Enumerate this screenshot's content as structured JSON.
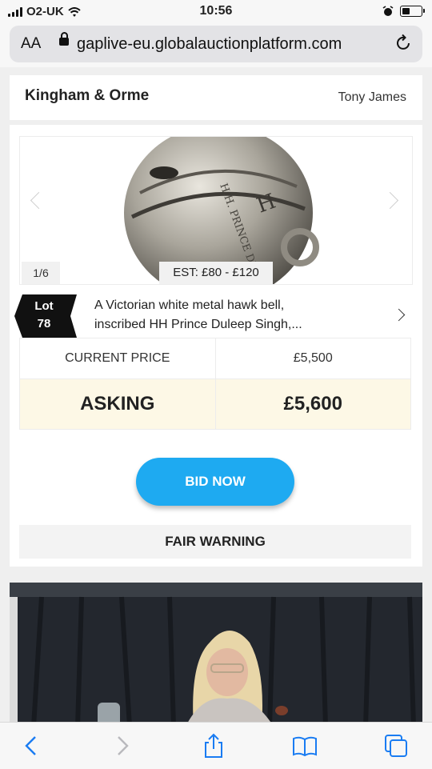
{
  "status_bar": {
    "carrier": "O2-UK",
    "time": "10:56"
  },
  "browser": {
    "text_size_label": "AA",
    "url": "gaplive-eu.globalauctionplatform.com"
  },
  "header": {
    "auction_house": "Kingham & Orme",
    "auctioneer": "Tony James"
  },
  "lot": {
    "image_counter": "1/6",
    "estimate": "EST: £80 - £120",
    "lot_label": "Lot",
    "lot_number": "78",
    "title_line1": "A Victorian white metal hawk bell,",
    "title_line2": "inscribed HH Prince Duleep Singh,...",
    "image_inscription": "H.H. PRINCE DULEEP SINGH"
  },
  "prices": {
    "current_label": "CURRENT PRICE",
    "current_value": "£5,500",
    "asking_label": "ASKING",
    "asking_value": "£5,600"
  },
  "actions": {
    "bid_label": "BID NOW",
    "fair_warning_label": "FAIR WARNING"
  },
  "colors": {
    "bid_button": "#1eaaf1",
    "asking_row_bg": "#fdf8e6",
    "lot_badge": "#111111"
  }
}
